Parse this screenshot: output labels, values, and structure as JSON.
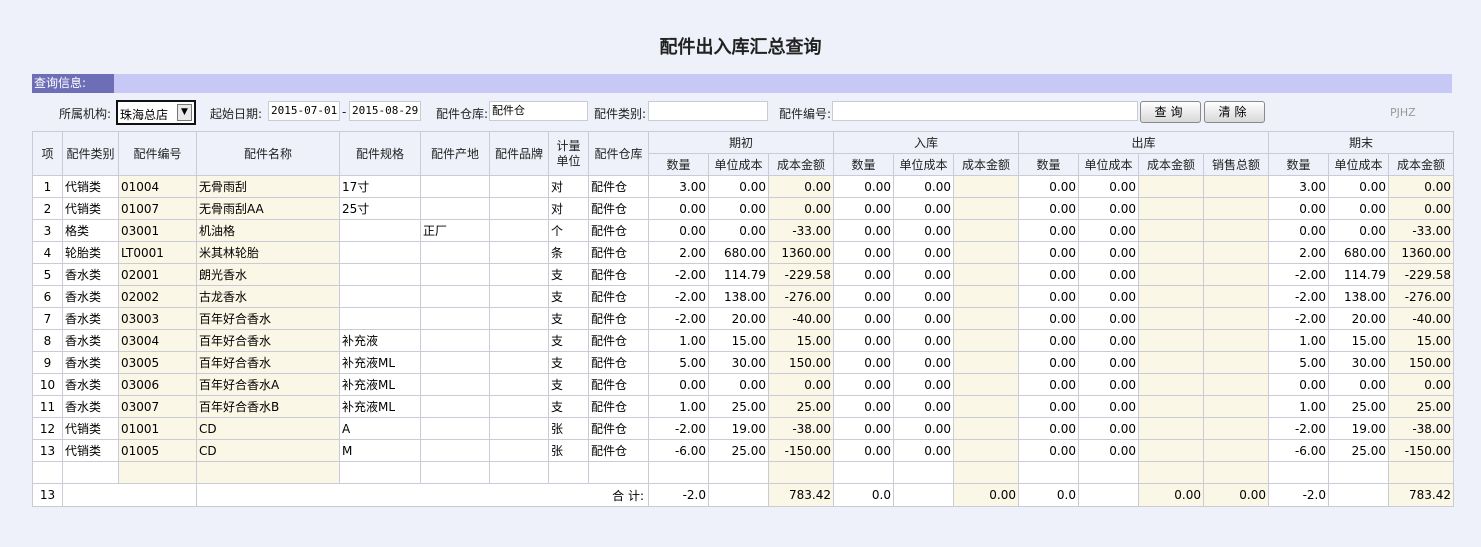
{
  "page": {
    "title": "配件出入库汇总查询",
    "section_label": "查询信息:",
    "code": "PJHZ"
  },
  "filters": {
    "org_label": "所属机构:",
    "org_value": "珠海总店",
    "start_date_label": "起始日期:",
    "start_date": "2015-07-01",
    "date_sep": "-",
    "end_date": "2015-08-29",
    "warehouse_label": "配件仓库:",
    "warehouse_value": "配件仓",
    "category_label": "配件类别:",
    "category_value": "",
    "part_no_label": "配件编号:",
    "part_no_value": "",
    "query_button": "查询",
    "clear_button": "清除"
  },
  "table": {
    "headers": {
      "idx": "项",
      "category": "配件类别",
      "code": "配件编号",
      "name": "配件名称",
      "spec": "配件规格",
      "origin": "配件产地",
      "brand": "配件品牌",
      "unit": "计量单位",
      "warehouse": "配件仓库",
      "group_begin": "期初",
      "group_in": "入库",
      "group_out": "出库",
      "group_end": "期末",
      "qty": "数量",
      "unit_cost": "单位成本",
      "cost_amount": "成本金额",
      "sales_total": "销售总额"
    },
    "rows": [
      {
        "idx": "1",
        "category": "代销类",
        "code": "01004",
        "name": "无骨雨刮",
        "spec": "17寸",
        "origin": "",
        "brand": "",
        "unit": "对",
        "warehouse": "配件仓",
        "b_qty": "3.00",
        "b_uc": "0.00",
        "b_amt": "0.00",
        "i_qty": "0.00",
        "i_uc": "0.00",
        "i_amt": "",
        "o_qty": "0.00",
        "o_uc": "0.00",
        "o_amt": "",
        "o_sales": "",
        "e_qty": "3.00",
        "e_uc": "0.00",
        "e_amt": "0.00"
      },
      {
        "idx": "2",
        "category": "代销类",
        "code": "01007",
        "name": "无骨雨刮AA",
        "spec": "25寸",
        "origin": "",
        "brand": "",
        "unit": "对",
        "warehouse": "配件仓",
        "b_qty": "0.00",
        "b_uc": "0.00",
        "b_amt": "0.00",
        "i_qty": "0.00",
        "i_uc": "0.00",
        "i_amt": "",
        "o_qty": "0.00",
        "o_uc": "0.00",
        "o_amt": "",
        "o_sales": "",
        "e_qty": "0.00",
        "e_uc": "0.00",
        "e_amt": "0.00"
      },
      {
        "idx": "3",
        "category": "格类",
        "code": "03001",
        "name": "机油格",
        "spec": "",
        "origin": "正厂",
        "brand": "",
        "unit": "个",
        "warehouse": "配件仓",
        "b_qty": "0.00",
        "b_uc": "0.00",
        "b_amt": "-33.00",
        "i_qty": "0.00",
        "i_uc": "0.00",
        "i_amt": "",
        "o_qty": "0.00",
        "o_uc": "0.00",
        "o_amt": "",
        "o_sales": "",
        "e_qty": "0.00",
        "e_uc": "0.00",
        "e_amt": "-33.00"
      },
      {
        "idx": "4",
        "category": "轮胎类",
        "code": "LT0001",
        "name": "米其林轮胎",
        "spec": "",
        "origin": "",
        "brand": "",
        "unit": "条",
        "warehouse": "配件仓",
        "b_qty": "2.00",
        "b_uc": "680.00",
        "b_amt": "1360.00",
        "i_qty": "0.00",
        "i_uc": "0.00",
        "i_amt": "",
        "o_qty": "0.00",
        "o_uc": "0.00",
        "o_amt": "",
        "o_sales": "",
        "e_qty": "2.00",
        "e_uc": "680.00",
        "e_amt": "1360.00"
      },
      {
        "idx": "5",
        "category": "香水类",
        "code": "02001",
        "name": "朗光香水",
        "spec": "",
        "origin": "",
        "brand": "",
        "unit": "支",
        "warehouse": "配件仓",
        "b_qty": "-2.00",
        "b_uc": "114.79",
        "b_amt": "-229.58",
        "i_qty": "0.00",
        "i_uc": "0.00",
        "i_amt": "",
        "o_qty": "0.00",
        "o_uc": "0.00",
        "o_amt": "",
        "o_sales": "",
        "e_qty": "-2.00",
        "e_uc": "114.79",
        "e_amt": "-229.58"
      },
      {
        "idx": "6",
        "category": "香水类",
        "code": "02002",
        "name": "古龙香水",
        "spec": "",
        "origin": "",
        "brand": "",
        "unit": "支",
        "warehouse": "配件仓",
        "b_qty": "-2.00",
        "b_uc": "138.00",
        "b_amt": "-276.00",
        "i_qty": "0.00",
        "i_uc": "0.00",
        "i_amt": "",
        "o_qty": "0.00",
        "o_uc": "0.00",
        "o_amt": "",
        "o_sales": "",
        "e_qty": "-2.00",
        "e_uc": "138.00",
        "e_amt": "-276.00"
      },
      {
        "idx": "7",
        "category": "香水类",
        "code": "03003",
        "name": "百年好合香水",
        "spec": "",
        "origin": "",
        "brand": "",
        "unit": "支",
        "warehouse": "配件仓",
        "b_qty": "-2.00",
        "b_uc": "20.00",
        "b_amt": "-40.00",
        "i_qty": "0.00",
        "i_uc": "0.00",
        "i_amt": "",
        "o_qty": "0.00",
        "o_uc": "0.00",
        "o_amt": "",
        "o_sales": "",
        "e_qty": "-2.00",
        "e_uc": "20.00",
        "e_amt": "-40.00"
      },
      {
        "idx": "8",
        "category": "香水类",
        "code": "03004",
        "name": "百年好合香水",
        "spec": "补充液",
        "origin": "",
        "brand": "",
        "unit": "支",
        "warehouse": "配件仓",
        "b_qty": "1.00",
        "b_uc": "15.00",
        "b_amt": "15.00",
        "i_qty": "0.00",
        "i_uc": "0.00",
        "i_amt": "",
        "o_qty": "0.00",
        "o_uc": "0.00",
        "o_amt": "",
        "o_sales": "",
        "e_qty": "1.00",
        "e_uc": "15.00",
        "e_amt": "15.00"
      },
      {
        "idx": "9",
        "category": "香水类",
        "code": "03005",
        "name": "百年好合香水",
        "spec": "补充液ML",
        "origin": "",
        "brand": "",
        "unit": "支",
        "warehouse": "配件仓",
        "b_qty": "5.00",
        "b_uc": "30.00",
        "b_amt": "150.00",
        "i_qty": "0.00",
        "i_uc": "0.00",
        "i_amt": "",
        "o_qty": "0.00",
        "o_uc": "0.00",
        "o_amt": "",
        "o_sales": "",
        "e_qty": "5.00",
        "e_uc": "30.00",
        "e_amt": "150.00"
      },
      {
        "idx": "10",
        "category": "香水类",
        "code": "03006",
        "name": "百年好合香水A",
        "spec": "补充液ML",
        "origin": "",
        "brand": "",
        "unit": "支",
        "warehouse": "配件仓",
        "b_qty": "0.00",
        "b_uc": "0.00",
        "b_amt": "0.00",
        "i_qty": "0.00",
        "i_uc": "0.00",
        "i_amt": "",
        "o_qty": "0.00",
        "o_uc": "0.00",
        "o_amt": "",
        "o_sales": "",
        "e_qty": "0.00",
        "e_uc": "0.00",
        "e_amt": "0.00"
      },
      {
        "idx": "11",
        "category": "香水类",
        "code": "03007",
        "name": "百年好合香水B",
        "spec": "补充液ML",
        "origin": "",
        "brand": "",
        "unit": "支",
        "warehouse": "配件仓",
        "b_qty": "1.00",
        "b_uc": "25.00",
        "b_amt": "25.00",
        "i_qty": "0.00",
        "i_uc": "0.00",
        "i_amt": "",
        "o_qty": "0.00",
        "o_uc": "0.00",
        "o_amt": "",
        "o_sales": "",
        "e_qty": "1.00",
        "e_uc": "25.00",
        "e_amt": "25.00"
      },
      {
        "idx": "12",
        "category": "代销类",
        "code": "01001",
        "name": "CD",
        "spec": "A",
        "origin": "",
        "brand": "",
        "unit": "张",
        "warehouse": "配件仓",
        "b_qty": "-2.00",
        "b_uc": "19.00",
        "b_amt": "-38.00",
        "i_qty": "0.00",
        "i_uc": "0.00",
        "i_amt": "",
        "o_qty": "0.00",
        "o_uc": "0.00",
        "o_amt": "",
        "o_sales": "",
        "e_qty": "-2.00",
        "e_uc": "19.00",
        "e_amt": "-38.00"
      },
      {
        "idx": "13",
        "category": "代销类",
        "code": "01005",
        "name": "CD",
        "spec": "M",
        "origin": "",
        "brand": "",
        "unit": "张",
        "warehouse": "配件仓",
        "b_qty": "-6.00",
        "b_uc": "25.00",
        "b_amt": "-150.00",
        "i_qty": "0.00",
        "i_uc": "0.00",
        "i_amt": "",
        "o_qty": "0.00",
        "o_uc": "0.00",
        "o_amt": "",
        "o_sales": "",
        "e_qty": "-6.00",
        "e_uc": "25.00",
        "e_amt": "-150.00"
      }
    ],
    "totals": {
      "count": "13",
      "label": "合 计:",
      "b_qty": "-2.0",
      "b_amt": "783.42",
      "i_qty": "0.0",
      "i_amt": "0.00",
      "o_qty": "0.0",
      "o_amt": "0.00",
      "o_sales": "0.00",
      "e_qty": "-2.0",
      "e_amt": "783.42"
    }
  }
}
